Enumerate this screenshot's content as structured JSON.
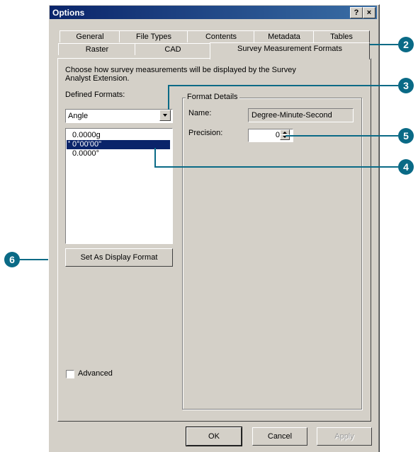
{
  "window": {
    "title": "Options",
    "help_button": "?",
    "close_button": "×"
  },
  "tabs": {
    "row1": [
      "General",
      "File Types",
      "Contents",
      "Metadata",
      "Tables"
    ],
    "row2": [
      "Raster",
      "CAD",
      "Survey Measurement Formats"
    ],
    "active": "Survey Measurement Formats"
  },
  "panel": {
    "description": "Choose how survey measurements will be displayed by the Survey Analyst Extension.",
    "defined_formats_label": "Defined Formats:",
    "format_type_value": "Angle",
    "formats_list": [
      {
        "marker": "",
        "text": "0.0000g",
        "selected": false
      },
      {
        "marker": "*",
        "text": "0°00'00\"",
        "selected": true
      },
      {
        "marker": "",
        "text": "0.0000°",
        "selected": false
      }
    ],
    "set_display_button": "Set As Display Format",
    "advanced_label": "Advanced",
    "advanced_checked": false
  },
  "format_details": {
    "group_label": "Format Details",
    "name_label": "Name:",
    "name_value": "Degree-Minute-Second",
    "precision_label": "Precision:",
    "precision_value": "0"
  },
  "footer": {
    "ok": "OK",
    "cancel": "Cancel",
    "apply": "Apply"
  },
  "callouts": [
    "2",
    "3",
    "4",
    "5",
    "6"
  ],
  "colors": {
    "callout": "#0a6a86",
    "title_start": "#0a246a",
    "title_end": "#3a6ea5",
    "selection": "#0a246a"
  }
}
